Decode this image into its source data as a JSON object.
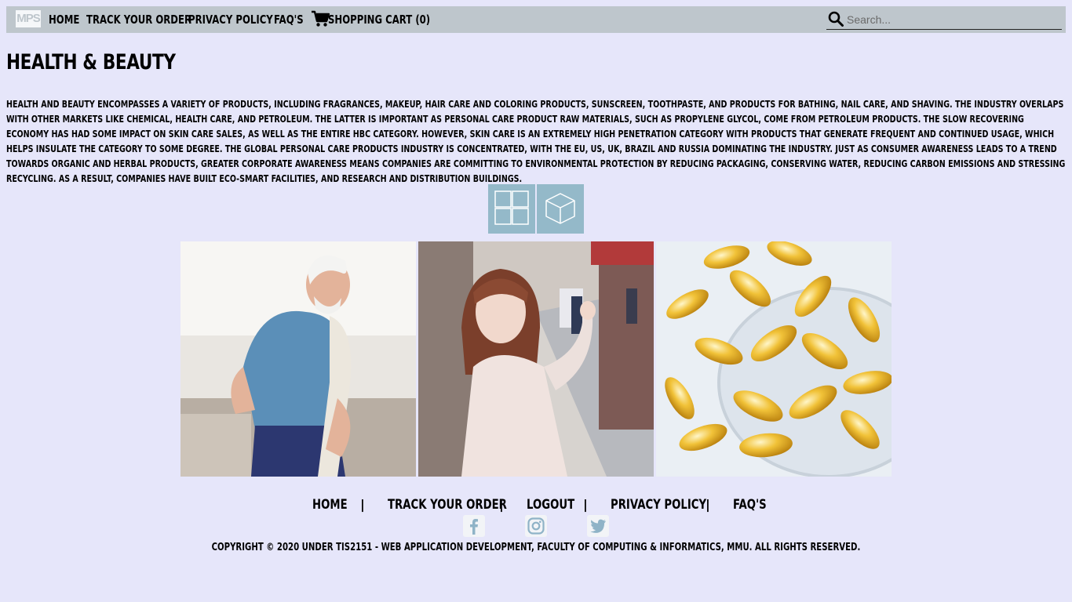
{
  "nav": {
    "logo_text": "MPS",
    "home": "HOME",
    "track": "TRACK YOUR ORDER",
    "privacy": "PRIVACY POLICY",
    "faq": "FAQ'S",
    "cart": "SHOPPING CART (0)",
    "search_placeholder": "Search..."
  },
  "page": {
    "title": "HEALTH & BEAUTY",
    "description": "HEALTH AND BEAUTY ENCOMPASSES A VARIETY OF PRODUCTS, INCLUDING FRAGRANCES, MAKEUP, HAIR CARE AND COLORING PRODUCTS, SUNSCREEN, TOOTHPASTE, AND PRODUCTS FOR BATHING, NAIL CARE, AND SHAVING. THE INDUSTRY OVERLAPS WITH OTHER MARKETS LIKE CHEMICAL, HEALTH CARE, AND PETROLEUM. THE LATTER IS IMPORTANT AS PERSONAL CARE PRODUCT RAW MATERIALS, SUCH AS PROPYLENE GLYCOL, COME FROM PETROLEUM PRODUCTS. THE SLOW RECOVERING ECONOMY HAS HAD SOME IMPACT ON SKIN CARE SALES, AS WELL AS THE ENTIRE HBC CATEGORY. HOWEVER, SKIN CARE IS AN EXTREMELY HIGH PENETRATION CATEGORY WITH PRODUCTS THAT GENERATE FREQUENT AND CONTINUED USAGE, WHICH HELPS INSULATE THE CATEGORY TO SOME DEGREE. THE GLOBAL PERSONAL CARE PRODUCTS INDUSTRY IS CONCENTRATED, WITH THE EU, US, UK, BRAZIL AND RUSSIA DOMINATING THE INDUSTRY. JUST AS CONSUMER AWARENESS LEADS TO A TREND TOWARDS ORGANIC AND HERBAL PRODUCTS, GREATER CORPORATE AWARENESS MEANS COMPANIES ARE COMMITTING TO ENVIRONMENTAL PROTECTION BY REDUCING PACKAGING, CONSERVING WATER, REDUCING CARBON EMISSIONS AND STRESSING RECYCLING. AS A RESULT, COMPANIES HAVE BUILT ECO-SMART FACILITIES, AND RESEARCH AND DISTRIBUTION BUILDINGS."
  },
  "footer": {
    "home": "HOME",
    "track": "TRACK YOUR ORDER",
    "logout": "LOGOUT",
    "privacy": "PRIVACY POLICY",
    "faq": "FAQ'S",
    "separator": "|",
    "copyright": "COPYRIGHT © 2020 UNDER TIS2151 - WEB APPLICATION DEVELOPMENT, FACULTY OF COMPUTING & INFORMATICS, MMU. ALL RIGHTS RESERVED."
  },
  "colors": {
    "page_bg": "#e6e6fa",
    "navbar_bg": "#bec6cc",
    "view_button_bg": "#94b9c9",
    "social_icon_color": "#8fb3c7"
  },
  "icons": [
    "logo-icon",
    "cart-icon",
    "search-icon",
    "grid-view-icon",
    "box-view-icon",
    "facebook-icon",
    "instagram-icon",
    "twitter-icon"
  ]
}
